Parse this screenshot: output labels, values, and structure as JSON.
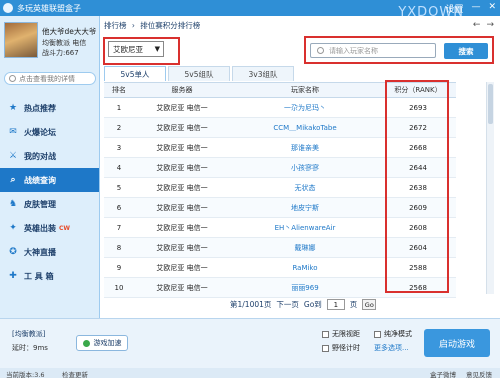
{
  "window": {
    "title": "多玩英雄联盟盒子",
    "watermark": "YXDOWN",
    "controls": [
      "设置",
      "—",
      "✕"
    ]
  },
  "profile": {
    "name": "他大爷de大大爷",
    "server": "均衡教派 电信",
    "power": "战斗力:667"
  },
  "sidebar_search": {
    "placeholder": "点击查看我的详情"
  },
  "menu": [
    {
      "label": "热点推荐",
      "icon": "star-icon",
      "glyph": "★",
      "active": false,
      "badge": ""
    },
    {
      "label": "火爆论坛",
      "icon": "chat-icon",
      "glyph": "✉",
      "active": false,
      "badge": ""
    },
    {
      "label": "我的对战",
      "icon": "swords-icon",
      "glyph": "⚔",
      "active": false,
      "badge": ""
    },
    {
      "label": "战绩查询",
      "icon": "search-icon",
      "glyph": "⌕",
      "active": true,
      "badge": ""
    },
    {
      "label": "皮肤管理",
      "icon": "shirt-icon",
      "glyph": "♞",
      "active": false,
      "badge": ""
    },
    {
      "label": "英雄出装",
      "icon": "gear-icon",
      "glyph": "✦",
      "active": false,
      "badge": "CW"
    },
    {
      "label": "大神直播",
      "icon": "broadcast-icon",
      "glyph": "✪",
      "active": false,
      "badge": ""
    },
    {
      "label": "工 具 箱",
      "icon": "wrench-icon",
      "glyph": "✚",
      "active": false,
      "badge": ""
    }
  ],
  "breadcrumb": [
    "排行榜",
    "›",
    "排位赛积分排行榜"
  ],
  "nav_arrows": [
    "←",
    "→"
  ],
  "server_select": {
    "value": "艾欧尼亚"
  },
  "player_search": {
    "placeholder": "请输入玩家名称",
    "button": "搜索"
  },
  "tabs": [
    {
      "label": "5v5单人",
      "active": true
    },
    {
      "label": "5v5组队",
      "active": false
    },
    {
      "label": "3v3组队",
      "active": false
    }
  ],
  "table": {
    "headers": [
      "排名",
      "服务器",
      "玩家名称",
      "积分（RANK）"
    ],
    "rows": [
      [
        "1",
        "艾欧尼亚 电信一",
        "一尕为尼玛丶",
        "2693"
      ],
      [
        "2",
        "艾欧尼亚 电信一",
        "CCM＿MikakoTabe",
        "2672"
      ],
      [
        "3",
        "艾欧尼亚 电信一",
        "那谁亲美",
        "2668"
      ],
      [
        "4",
        "艾欧尼亚 电信一",
        "小孩寥寥",
        "2644"
      ],
      [
        "5",
        "艾欧尼亚 电信一",
        "无状态",
        "2638"
      ],
      [
        "6",
        "艾欧尼亚 电信一",
        "地皮宁斯",
        "2609"
      ],
      [
        "7",
        "艾欧尼亚 电信一",
        "EH丶AlienwareAir",
        "2608"
      ],
      [
        "8",
        "艾欧尼亚 电信一",
        "戴琳娜",
        "2604"
      ],
      [
        "9",
        "艾欧尼亚 电信一",
        "RaMiko",
        "2588"
      ],
      [
        "10",
        "艾欧尼亚 电信一",
        "丽丽969",
        "2568"
      ]
    ]
  },
  "pager": {
    "page_info": "第1/1001页",
    "next": "下一页",
    "goto_prefix": "Go到",
    "goto_value": "1",
    "goto_suffix": "页",
    "go_button": "Go"
  },
  "bottom": {
    "mode": "[均衡教派]",
    "delay": "延时：9ms",
    "accelerate": "游戏加速",
    "options": [
      "无限视距",
      "纯净模式",
      "野怪计时",
      "更多选项..."
    ],
    "start": "启动游戏"
  },
  "statusbar": {
    "version": "当前版本:3.6",
    "update": "检查更新",
    "right": [
      "盒子微博",
      "意见反馈"
    ]
  },
  "colors": {
    "accent": "#2f8fd6",
    "highlight_border": "#d9302e",
    "active_menu": "#1e78c8"
  }
}
